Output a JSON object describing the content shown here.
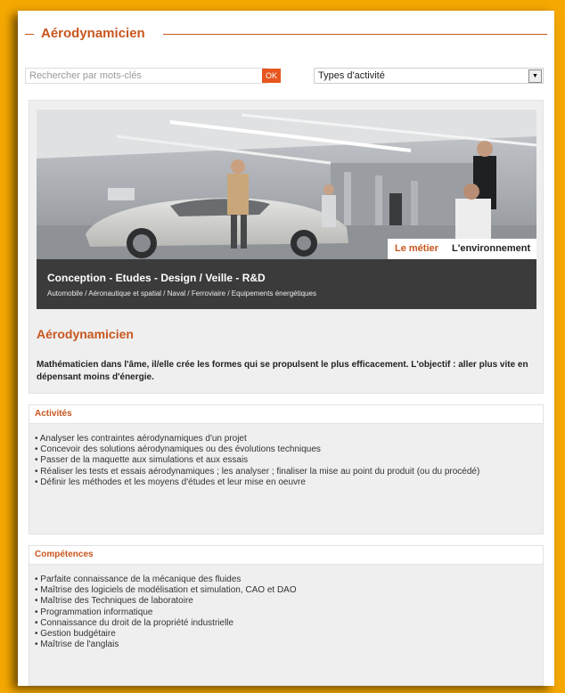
{
  "page": {
    "title": "Aérodynamicien"
  },
  "search": {
    "placeholder": "Rechercher par mots-clés",
    "ok_label": "OK"
  },
  "filter": {
    "selected": "Types d'activité"
  },
  "hero": {
    "category": "Conception - Etudes - Design / Veille - R&D",
    "sectors": "Automobile / Aéronautique et spatial / Naval / Ferroviaire / Equipements énergétiques",
    "tabs": [
      {
        "label": "Le métier"
      },
      {
        "label": "L'environnement"
      }
    ]
  },
  "job": {
    "title": "Aérodynamicien",
    "description": "Mathématicien dans l'âme, il/elle crée les formes qui se propulsent le plus efficacement. L'objectif : aller plus vite en dépensant moins d'énergie."
  },
  "activites": {
    "heading": "Activités",
    "items": [
      "• Analyser les contraintes aérodynamiques d'un projet",
      "• Concevoir des solutions aérodynamiques ou des évolutions techniques",
      "• Passer de la maquette aux simulations et aux essais",
      "• Réaliser les tests et essais aérodynamiques ; les analyser ; finaliser la mise au point du produit (ou du procédé)",
      "• Définir les méthodes et les moyens d'études et leur mise en oeuvre"
    ]
  },
  "competences": {
    "heading": "Compétences",
    "items": [
      "• Parfaite connaissance de la mécanique des fluides",
      "• Maîtrise des logiciels de modélisation et simulation, CAO et DAO",
      "• Maîtrise des Techniques de laboratoire",
      "• Programmation informatique",
      "• Connaissance du droit de la propriété industrielle",
      "• Gestion budgétaire",
      "• Maîtrise de l'anglais"
    ]
  },
  "colors": {
    "accent": "#c8561e",
    "frame": "#f5a800",
    "caption_bg": "#3b3b3b"
  }
}
